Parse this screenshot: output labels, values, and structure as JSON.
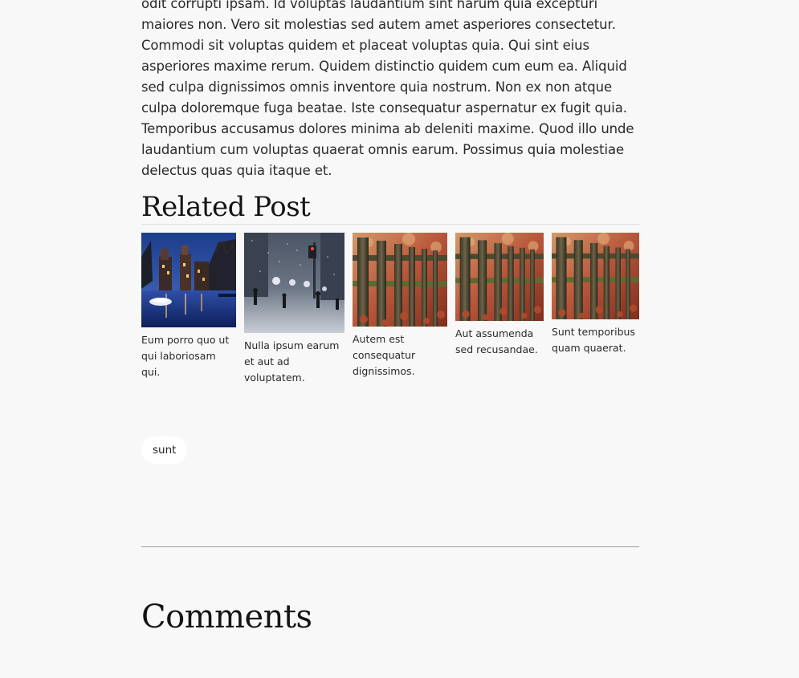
{
  "article": {
    "body": "odit corrupti ipsam. Id voluptas laudantium sint harum quia excepturi maiores non. Vero sit molestias sed autem amet asperiores consectetur. Commodi sit voluptas quidem et placeat voluptas quia. Qui sint eius asperiores maxime rerum. Quidem distinctio quidem cum eum ea. Aliquid sed culpa dignissimos omnis inventore quia nostrum. Non ex non atque culpa doloremque fuga beatae. Iste consequatur aspernatur ex fugit quia. Temporibus accusamus dolores minima ab deleniti maxime. Quod illo unde laudantium cum voluptas quaerat omnis earum. Possimus quia molestiae delectus quas quia itaque et."
  },
  "related": {
    "title": "Related Post",
    "posts": [
      {
        "caption": "Eum porro quo ut qui laboriosam qui.",
        "image": "canal-night-photo"
      },
      {
        "caption": "Nulla ipsum earum et aut ad voluptatem.",
        "image": "snowy-street-photo"
      },
      {
        "caption": "Autem est consequatur dignissimos.",
        "image": "wooden-fence-photo"
      },
      {
        "caption": "Aut assumenda sed recusandae.",
        "image": "wooden-fence-photo"
      },
      {
        "caption": "Sunt temporibus quam quaerat.",
        "image": "wooden-fence-photo"
      }
    ]
  },
  "tags": [
    "sunt"
  ],
  "comments": {
    "title": "Comments"
  },
  "colors": {
    "background": "#f8f8f8",
    "text": "#2a2a2a",
    "heading": "#141414",
    "tag_background": "#ffffff",
    "divider": "#9a9a9a"
  }
}
